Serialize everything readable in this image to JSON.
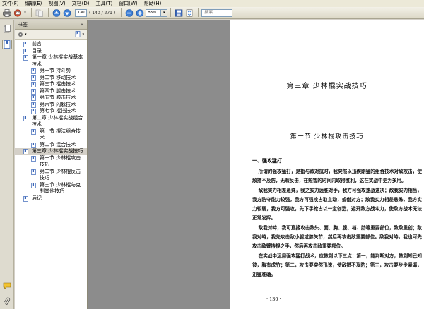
{
  "menu": [
    "文件(F)",
    "编辑(E)",
    "视图(V)",
    "文档(D)",
    "工具(T)",
    "窗口(W)",
    "帮助(H)"
  ],
  "toolbar": {
    "current_page": "130",
    "page_count": "( 140 / 271 )",
    "zoom": "63%",
    "search_placeholder": "搜索"
  },
  "bookmarks": {
    "title": "书签",
    "close": "×",
    "items": [
      {
        "label": "前言",
        "indent": 0,
        "selected": false
      },
      {
        "label": "目录",
        "indent": 0,
        "selected": false
      },
      {
        "label": "第一章  少林棍实战基本技术",
        "indent": 0,
        "selected": false
      },
      {
        "label": "第一节  持斗势",
        "indent": 1,
        "selected": false
      },
      {
        "label": "第二节  移动技术",
        "indent": 1,
        "selected": false
      },
      {
        "label": "第三节  棍击技术",
        "indent": 1,
        "selected": false
      },
      {
        "label": "第四节  腿击技术",
        "indent": 1,
        "selected": false
      },
      {
        "label": "第五节  膝击技术",
        "indent": 1,
        "selected": false
      },
      {
        "label": "第六节  闪躲技术",
        "indent": 1,
        "selected": false
      },
      {
        "label": "第七节  棍挡技术",
        "indent": 1,
        "selected": false
      },
      {
        "label": "第二章  少林棍实战组合技术",
        "indent": 0,
        "selected": false
      },
      {
        "label": "第一节  棍法组合技术",
        "indent": 1,
        "selected": false
      },
      {
        "label": "第二节  混合技术",
        "indent": 1,
        "selected": false
      },
      {
        "label": "第三章  少林棍实战技巧",
        "indent": 0,
        "selected": true
      },
      {
        "label": "第一节  少林棍攻击技巧",
        "indent": 1,
        "selected": false
      },
      {
        "label": "第二节  少林棍反击技巧",
        "indent": 1,
        "selected": false
      },
      {
        "label": "第三节  少林棍与克制其他技巧",
        "indent": 1,
        "selected": false
      },
      {
        "label": "后记",
        "indent": 0,
        "selected": false
      }
    ]
  },
  "document": {
    "chapter_title": "第三章   少林棍实战技巧",
    "section_title": "第一节   少林棍攻击技巧",
    "sub_heading": "一、强攻猛打",
    "paragraphs": [
      "所谓的强攻猛打，是指与敌对抗时，我突然以迅疾刚猛的组合技术对敌攻击，使敌措不及防，无暇反击，在短暂的时间内取得胜利，这在实战中更为多用。",
      "敌我实力相差悬殊，我之实力远胜对手，我方可强攻速战速决；敌我实力相当，我方防守能力较强，我方可强攻占取主动，或借对方；敌我实力相差悬殊，我方实力较弱，我方可强攻，先下手抢占以一定创造，避开敌方战斗力，使敌方战术无法正常发挥。",
      "敌我对峙，我可直接攻击敌头、面、胸、腹、裆、肋等重要部位，致敌重创；敌我对峙，我先攻击敌小腿或膝关节，然后再攻击敌重要部位。敌我对峙，我也可先攻击敌臂持棍之手，然后再攻击敌重要部位。",
      "在实战中运用强攻猛打战术，应做到以下三点：第一，能判断对方，做到知己知彼，胸有成竹；第二，攻击要突然迅速，使敌措不及防；第三，攻击要步步紧逼，迅猛准确。"
    ],
    "page_number": "· 130 ·"
  }
}
